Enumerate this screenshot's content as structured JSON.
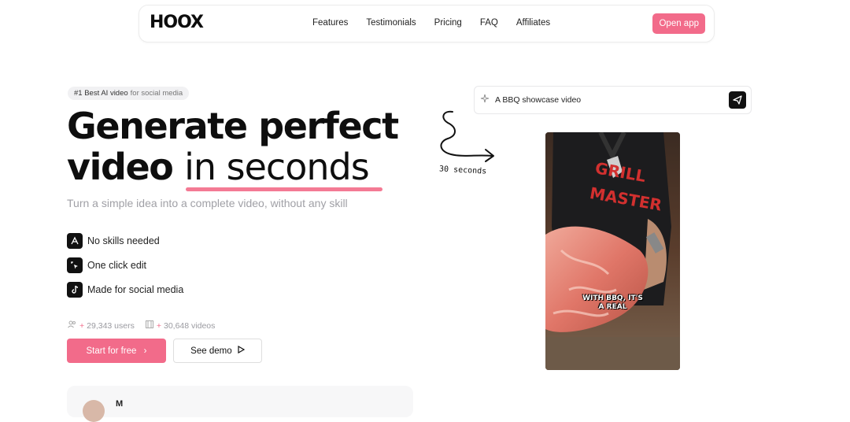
{
  "nav": {
    "logo": "HOOX",
    "links": [
      "Features",
      "Testimonials",
      "Pricing",
      "FAQ",
      "Affiliates"
    ],
    "cta": "Open app"
  },
  "hero": {
    "badge_main": "#1 Best AI video",
    "badge_sub": "for social media",
    "title_line1": "Generate perfect",
    "title_line2_bold": "video",
    "title_line2_light": "in seconds",
    "subtitle": "Turn a simple idea into a complete video, without any skill",
    "features": [
      {
        "label": "No skills needed",
        "icon": "magic-wand-icon"
      },
      {
        "label": "One click edit",
        "icon": "cursor-click-icon"
      },
      {
        "label": "Made for social media",
        "icon": "tiktok-icon"
      }
    ],
    "stats": {
      "users_prefix": "+",
      "users": "29,343 users",
      "videos_prefix": "+",
      "videos": "30,648 videos"
    },
    "primary_button": "Start for free",
    "secondary_button": "See demo",
    "testimonial_name": "M"
  },
  "demo": {
    "prompt_text": "A BBQ showcase video",
    "arrow_label": "30 seconds",
    "video_caption_line1": "WITH BBQ, IT'S",
    "video_caption_line2": "A REAL",
    "shirt_text_1": "GRILL",
    "shirt_text_2": "MASTER"
  },
  "colors": {
    "accent": "#f26b8a",
    "dark": "#111111",
    "muted": "#a0a0a6"
  }
}
